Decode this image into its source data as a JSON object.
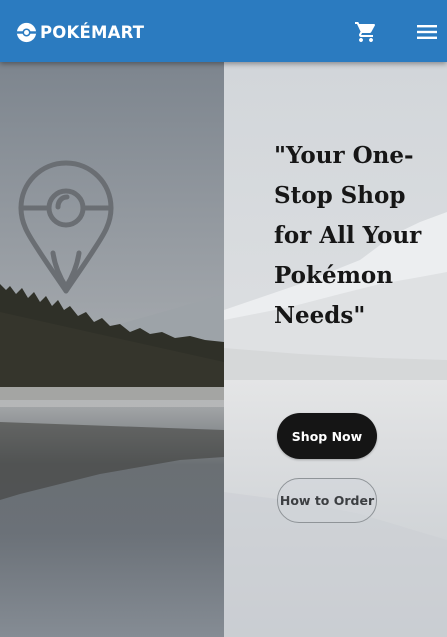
{
  "header": {
    "brand": "POKÉMART",
    "colors": {
      "background": "#2b7bc0",
      "text": "#ffffff"
    },
    "icons": [
      "pokeball-icon",
      "cart-icon",
      "hamburger-menu-icon"
    ]
  },
  "hero": {
    "headline": "\"Your One-Stop Shop for All Your Pokémon Needs\"",
    "primary_button": "Shop Now",
    "secondary_button": "How to Order",
    "icons": [
      "location-pin-pokeball-icon"
    ],
    "colors": {
      "primary_button": "#151515",
      "headline": "#161616"
    }
  }
}
